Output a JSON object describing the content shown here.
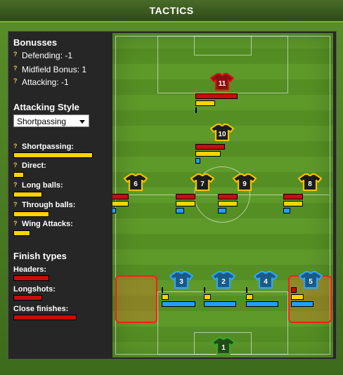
{
  "title": "TACTICS",
  "bonusses": {
    "heading": "Bonusses",
    "items": [
      "Defending: -1",
      "Midfield Bonus: 1",
      "Attacking: -1"
    ]
  },
  "attacking_style": {
    "heading": "Attacking Style",
    "selected": "Shortpassing",
    "items": [
      {
        "label": "Shortpassing:",
        "level": 0.85
      },
      {
        "label": "Direct:",
        "level": 0.1
      },
      {
        "label": "Long balls:",
        "level": 0.3
      },
      {
        "label": "Through balls:",
        "level": 0.38
      },
      {
        "label": "Wing Attacks:",
        "level": 0.17
      }
    ]
  },
  "finish_types": {
    "heading": "Finish types",
    "items": [
      {
        "label": "Headers:",
        "level": 0.38
      },
      {
        "label": "Longshots:",
        "level": 0.3
      },
      {
        "label": "Close finishes:",
        "level": 0.68
      }
    ]
  },
  "players": [
    {
      "number": "11",
      "kit": "red"
    },
    {
      "number": "10",
      "kit": "yellow"
    },
    {
      "number": "6",
      "kit": "yellow"
    },
    {
      "number": "7",
      "kit": "yellow"
    },
    {
      "number": "9",
      "kit": "yellow"
    },
    {
      "number": "8",
      "kit": "yellow"
    },
    {
      "number": "3",
      "kit": "blue"
    },
    {
      "number": "2",
      "kit": "blue"
    },
    {
      "number": "4",
      "kit": "blue"
    },
    {
      "number": "5",
      "kit": "blue"
    },
    {
      "number": "1",
      "kit": "green"
    }
  ],
  "colors": {
    "yellow": "#ffd200",
    "red": "#cc0b0b",
    "blue": "#1fa0ff",
    "green": "#2e7d1f"
  }
}
